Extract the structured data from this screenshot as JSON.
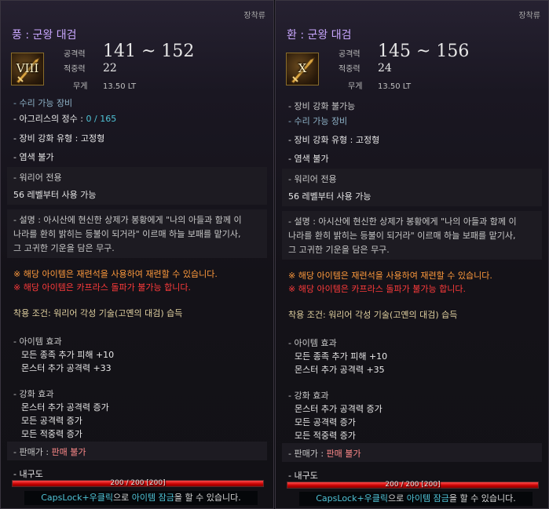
{
  "panels": [
    {
      "category": "장착류",
      "name": "풍 : 군왕 대검",
      "grade": "VIII",
      "stats": {
        "attack_label": "공격력",
        "attack_value": "141 ~ 152",
        "accuracy_label": "적중력",
        "accuracy_value": "22",
        "weight_label": "무게",
        "weight_value": "13.50 LT"
      },
      "repair": "- 수리 가능 장비",
      "agris_label": "- 아그리스의 정수 : ",
      "agris_value": "0 / 165",
      "enhance_type": "- 장비 강화 유형 : 고정형",
      "dye": "- 염색 불가",
      "class_only": "- 워리어 전용",
      "level_req": "56 레벨부터 사용 가능",
      "desc1": "- 설명 : 아시산에 현신한 상제가 봉황에게 \"나의 아들과 함께 이",
      "desc2": "나라를 환히 밝히는 등불이 되거라\" 이르매 하늘 보패를 맡기사,",
      "desc3": "그 고귀한 기운을 담은 무구.",
      "note_orange": "※ 해당 아이템은 재련석을 사용하여 재련할 수 있습니다.",
      "note_red": "※ 해당 아이템은 카프라스 돌파가 불가능 합니다.",
      "equip_cond": "착용 조건: 워리어 각성 기술(고옌의 대검) 습득",
      "item_effect_title": "- 아이템 효과",
      "item_effect_1": "모든 종족 추가 피해 +10",
      "item_effect_2": "몬스터 추가 공격력 +33",
      "enh_title": "- 강화 효과",
      "enh_1": "몬스터 추가 공격력 증가",
      "enh_2": "모든 공격력 증가",
      "enh_3": "모든 적중력 증가",
      "sell_label": "- 판매가 : ",
      "sell_value": "판매 불가",
      "durability_label": "- 내구도",
      "durability_fraction": 1.0,
      "durability_text": "200 / 200 [200]",
      "lock_hint_key": "CapsLock+우클릭",
      "lock_hint_mid": "으로 ",
      "lock_hint_link": "아이템 잠금",
      "lock_hint_end": "을 할 수 있습니다."
    },
    {
      "category": "장착류",
      "name": "환 : 군왕 대검",
      "grade": "X",
      "stats": {
        "attack_label": "공격력",
        "attack_value": "145 ~ 156",
        "accuracy_label": "적중력",
        "accuracy_value": "24",
        "weight_label": "무게",
        "weight_value": "13.50 LT"
      },
      "no_enhance": "- 장비 강화 불가능",
      "repair": "- 수리 가능 장비",
      "enhance_type": "- 장비 강화 유형 : 고정형",
      "dye": "- 염색 불가",
      "class_only": "- 워리어 전용",
      "level_req": "56 레벨부터 사용 가능",
      "desc1": "- 설명 : 아시산에 현신한 상제가 봉황에게 \"나의 아들과 함께 이",
      "desc2": "나라를 환히 밝히는 등불이 되거라\" 이르매 하늘 보패를 맡기사,",
      "desc3": "그 고귀한 기운을 담은 무구.",
      "note_orange": "※ 해당 아이템은 재련석을 사용하여 재련할 수 있습니다.",
      "note_red": "※ 해당 아이템은 카프라스 돌파가 불가능 합니다.",
      "equip_cond": "착용 조건: 워리어 각성 기술(고옌의 대검) 습득",
      "item_effect_title": "- 아이템 효과",
      "item_effect_1": "모든 종족 추가 피해 +10",
      "item_effect_2": "몬스터 추가 공격력 +35",
      "enh_title": "- 강화 효과",
      "enh_1": "몬스터 추가 공격력 증가",
      "enh_2": "모든 공격력 증가",
      "enh_3": "모든 적중력 증가",
      "sell_label": "- 판매가 : ",
      "sell_value": "판매 불가",
      "durability_label": "- 내구도",
      "durability_fraction": 1.0,
      "durability_text": "200 / 200 [200]",
      "lock_hint_key": "CapsLock+우클릭",
      "lock_hint_mid": "으로 ",
      "lock_hint_link": "아이템 잠금",
      "lock_hint_end": "을 할 수 있습니다."
    }
  ]
}
